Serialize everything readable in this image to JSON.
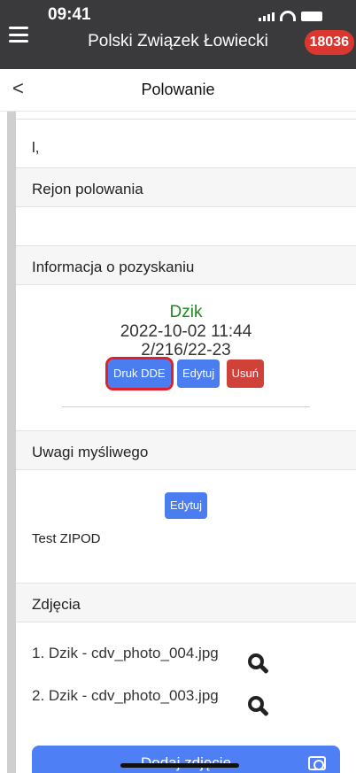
{
  "status_bar": {
    "time": "09:41",
    "badge_count": "18036"
  },
  "header": {
    "app_title": "Polski Związek Łowiecki",
    "menu_icon": "hamburger-icon",
    "mail_icon": "mail-icon"
  },
  "nav": {
    "back_label": "<",
    "title": "Polowanie"
  },
  "content": {
    "top_text": "l,",
    "region_heading": "Rejon polowania",
    "harvest_heading": "Informacja o pozyskaniu",
    "harvest": {
      "species": "Dzik",
      "datetime": "2022-10-02 11:44",
      "number": "2/216/22-23",
      "buttons": {
        "print": "Druk DDE",
        "edit": "Edytuj",
        "delete": "Usuń"
      }
    },
    "hunter_notes_heading": "Uwagi myśliwego",
    "hunter_notes_edit": "Edytuj",
    "hunter_notes_text": "Test ZIPOD",
    "photos_heading": "Zdjęcia",
    "photos": [
      {
        "label": "1. Dzik - cdv_photo_004.jpg"
      },
      {
        "label": "2. Dzik - cdv_photo_003.jpg"
      }
    ],
    "add_photo_button": "Dodaj zdjęcie"
  },
  "colors": {
    "header_bg": "#3a3a3c",
    "accent_blue": "#4a7df0",
    "danger_red": "#d0413a",
    "species_green": "#1f8a1f",
    "badge_red": "#d9372f"
  }
}
